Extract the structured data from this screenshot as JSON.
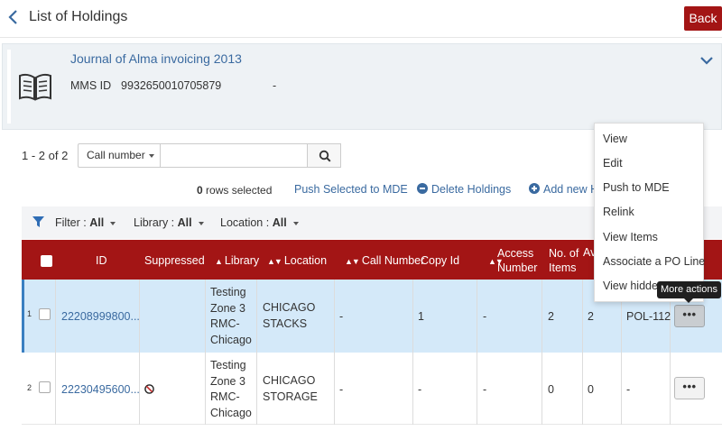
{
  "header": {
    "title": "List of Holdings",
    "back_label": "Back"
  },
  "record": {
    "title": "Journal of Alma invoicing 2013",
    "mms_label": "MMS ID",
    "mms_value": "9932650010705879",
    "extra": "-"
  },
  "search": {
    "count": "1 - 2 of 2",
    "field": "Call number",
    "placeholder": ""
  },
  "actions": {
    "rows_selected_count": "0",
    "rows_selected_text": " rows selected",
    "push_selected": "Push Selected to MDE",
    "delete_holdings": "Delete Holdings",
    "add_new": "Add new Ho"
  },
  "filters": [
    {
      "label": "Filter : ",
      "value": "All"
    },
    {
      "label": "Library : ",
      "value": "All"
    },
    {
      "label": "Location : ",
      "value": "All"
    }
  ],
  "table": {
    "columns": {
      "id": "ID",
      "suppressed": "Suppressed",
      "library": "Library",
      "location": "Location",
      "call_number": "Call Number",
      "copy_id": "Copy Id",
      "access_number_1": "Access",
      "access_number_2": "Number",
      "items_1": "No. of",
      "items_2": "Items",
      "available": "Av"
    },
    "rows": [
      {
        "id": "22208999800...",
        "library": [
          "Testing",
          "Zone 3",
          "RMC-",
          "Chicago"
        ],
        "location": [
          "CHICAGO",
          "STACKS"
        ],
        "call_number": "-",
        "copy_id": "1",
        "access_number": "-",
        "items": "2",
        "available": "2",
        "po_line": "POL-112",
        "index_glyph": "1"
      },
      {
        "id": "22230495600...",
        "library": [
          "Testing",
          "Zone 3",
          "RMC-",
          "Chicago"
        ],
        "location": [
          "CHICAGO",
          "STORAGE"
        ],
        "call_number": "-",
        "copy_id": "-",
        "access_number": "-",
        "items": "0",
        "available": "0",
        "po_line": "-",
        "index_glyph": "2"
      }
    ]
  },
  "row_menu": {
    "items": [
      "View",
      "Edit",
      "Push to MDE",
      "Relink",
      "View Items",
      "Associate a PO Line",
      "View hidden"
    ]
  },
  "more_label": "•••",
  "tooltip": "More actions",
  "colors": {
    "primary": "#a31515",
    "link": "#3a6aa0",
    "selected_row": "#d4e9f9"
  }
}
